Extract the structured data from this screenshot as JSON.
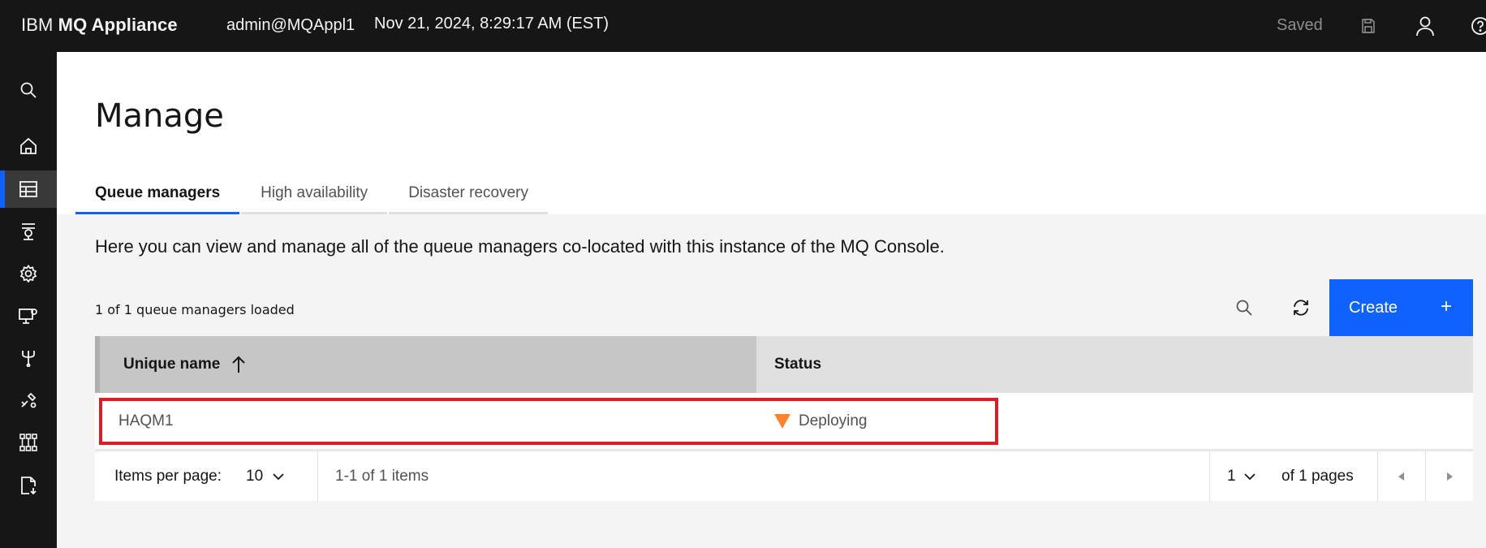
{
  "header": {
    "brand_prefix": "IBM",
    "brand_product": "MQ Appliance",
    "user": "admin@MQAppl1",
    "datetime": "Nov 21, 2024, 8:29:17 AM (EST)",
    "saved_label": "Saved",
    "icons": [
      "save-icon",
      "user-icon",
      "help-icon"
    ]
  },
  "sidebar": {
    "items": [
      {
        "icon": "search-icon"
      },
      {
        "icon": "home-icon"
      },
      {
        "icon": "table-icon",
        "active": true
      },
      {
        "icon": "queue-icon"
      },
      {
        "icon": "gear-icon"
      },
      {
        "icon": "monitor-settings-icon"
      },
      {
        "icon": "network-icon"
      },
      {
        "icon": "tools-icon"
      },
      {
        "icon": "data-structure-icon"
      },
      {
        "icon": "document-export-icon"
      }
    ]
  },
  "page": {
    "title": "Manage",
    "tabs": [
      {
        "label": "Queue managers",
        "active": true
      },
      {
        "label": "High availability"
      },
      {
        "label": "Disaster recovery"
      }
    ],
    "description": "Here you can view and manage all of the queue managers co-located with this instance of the MQ Console.",
    "loaded_text": "1 of 1 queue managers loaded",
    "create_label": "Create",
    "create_icon": "+"
  },
  "table": {
    "columns": [
      "Unique name",
      "Status"
    ],
    "rows": [
      {
        "name": "HAQM1",
        "status": "Deploying",
        "status_color": "#ff832b"
      }
    ]
  },
  "pagination": {
    "items_per_page_label": "Items per page:",
    "items_per_page": "10",
    "range_text": "1-1 of 1 items",
    "current_page": "1",
    "pages_text": "of 1 pages"
  },
  "colors": {
    "accent": "#0f62fe",
    "highlight": "#da1e28",
    "warning": "#ff832b"
  }
}
